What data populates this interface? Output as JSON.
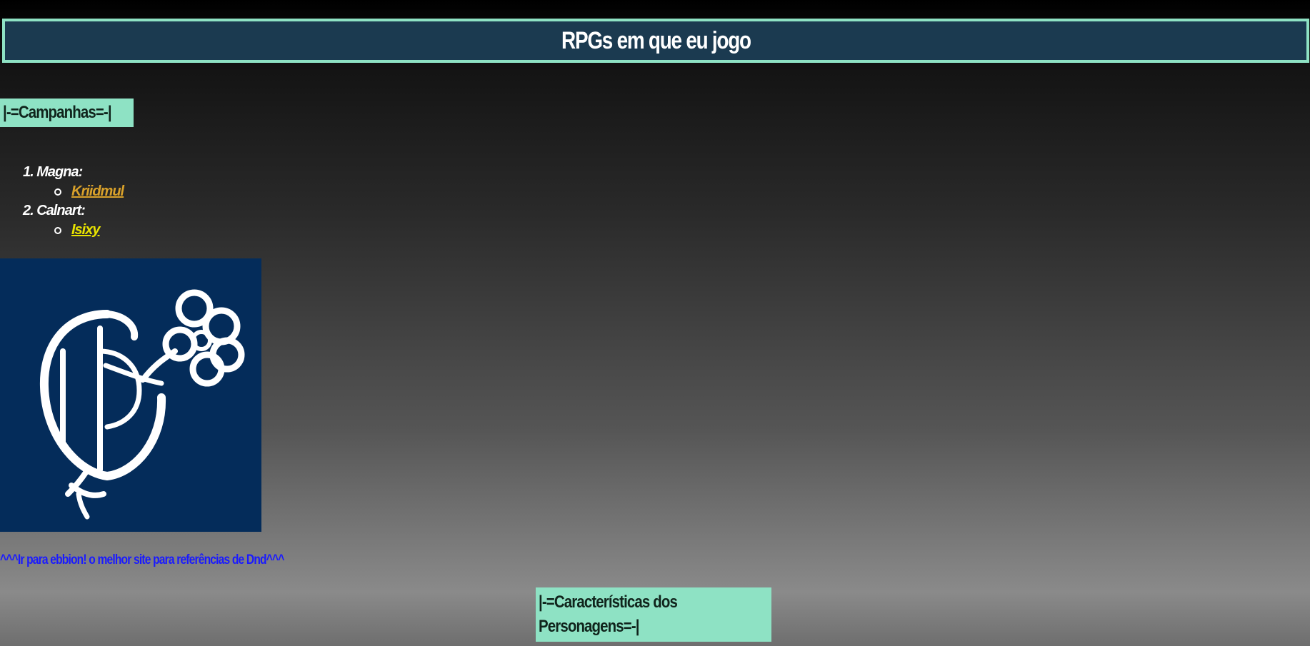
{
  "header": {
    "title": "RPGs em que eu jogo"
  },
  "campanhas": {
    "heading": "|-=Campanhas=-|",
    "items": [
      {
        "label": "1. Magna:",
        "sub": [
          {
            "label": "Kriidmul",
            "color": "#d9a12a"
          }
        ]
      },
      {
        "label": "2. Calnart:",
        "sub": [
          {
            "label": "Isixy",
            "color": "#e8e300"
          }
        ]
      }
    ]
  },
  "emblem": {
    "icon": "dnd-ampersand-emblem-icon",
    "background": "#042c5a"
  },
  "ebbion": {
    "link_text": "^^^Ir para ebbion! o melhor site para referências de Dnd^^^"
  },
  "caracteristicas": {
    "heading": "|-=Características dos Personagens=-|"
  },
  "colors": {
    "accent": "#8ee2c4",
    "title_bg": "#1b3a50",
    "link": "#1a1aff"
  }
}
